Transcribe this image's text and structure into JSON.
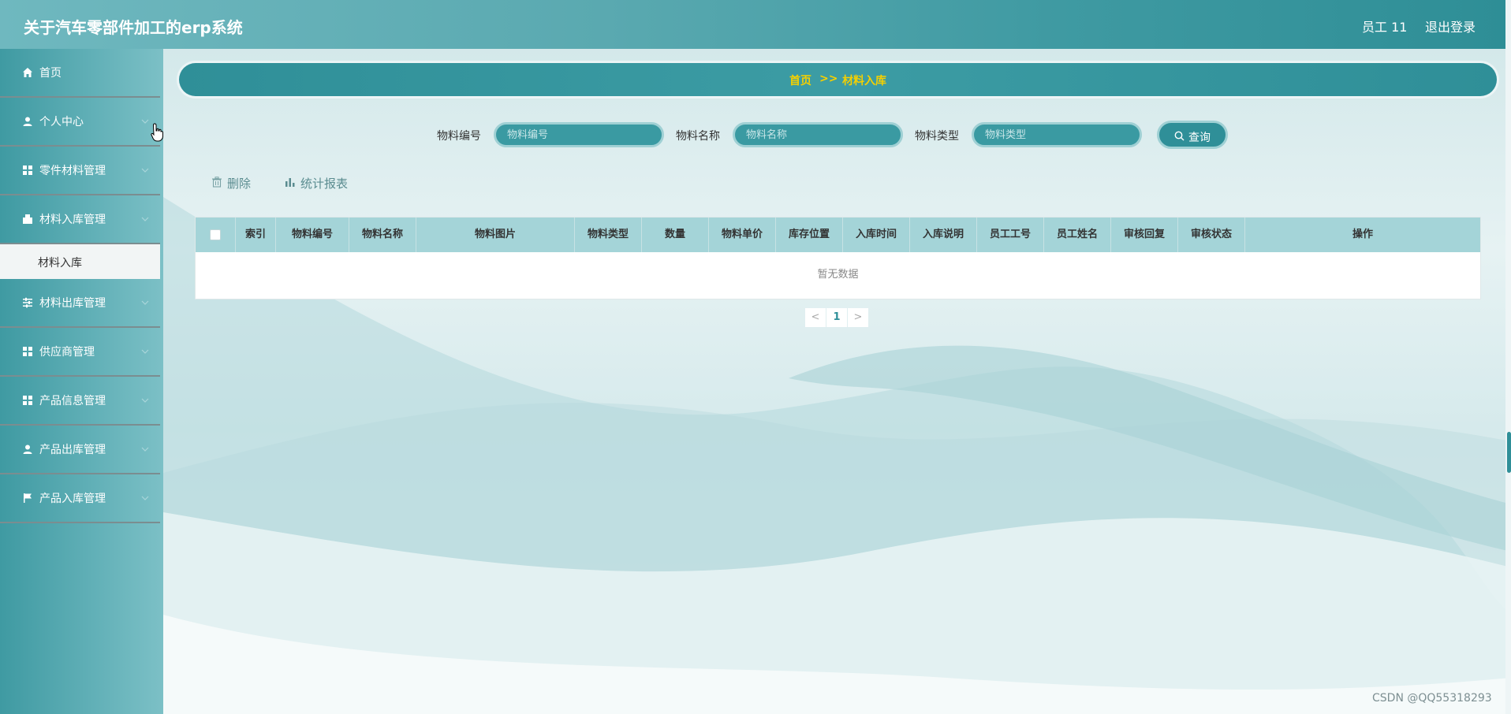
{
  "header": {
    "title": "关于汽车零部件加工的erp系统",
    "user": "员工 11",
    "logout": "退出登录"
  },
  "sidebar": {
    "items": [
      {
        "label": "首页",
        "icon": "home-icon"
      },
      {
        "label": "个人中心",
        "icon": "user-icon"
      },
      {
        "label": "零件材料管理",
        "icon": "grid-icon"
      },
      {
        "label": "材料入库管理",
        "icon": "inbox-icon"
      },
      {
        "label": "材料出库管理",
        "icon": "sliders-icon"
      },
      {
        "label": "供应商管理",
        "icon": "grid-icon"
      },
      {
        "label": "产品信息管理",
        "icon": "grid-icon"
      },
      {
        "label": "产品出库管理",
        "icon": "user-icon"
      },
      {
        "label": "产品入库管理",
        "icon": "flag-icon"
      }
    ],
    "submenu_active": "材料入库"
  },
  "breadcrumb": {
    "home": "首页",
    "separator": ">>",
    "current": "材料入库"
  },
  "search": {
    "fields": [
      {
        "label": "物料编号",
        "placeholder": "物料编号"
      },
      {
        "label": "物料名称",
        "placeholder": "物料名称"
      },
      {
        "label": "物料类型",
        "placeholder": "物料类型"
      }
    ],
    "button": "查询"
  },
  "actions": {
    "delete": "删除",
    "report": "统计报表"
  },
  "table": {
    "columns": [
      "索引",
      "物料编号",
      "物料名称",
      "物料图片",
      "物料类型",
      "数量",
      "物料单价",
      "库存位置",
      "入库时间",
      "入库说明",
      "员工工号",
      "员工姓名",
      "审核回复",
      "审核状态",
      "操作"
    ],
    "empty_text": "暂无数据"
  },
  "pagination": {
    "prev": "<",
    "current": "1",
    "next": ">"
  },
  "watermark": "CSDN @QQ55318293",
  "colors": {
    "accent": "#2f8f98",
    "breadcrumb_text": "#f5d000",
    "table_header": "#a4d4d8"
  }
}
